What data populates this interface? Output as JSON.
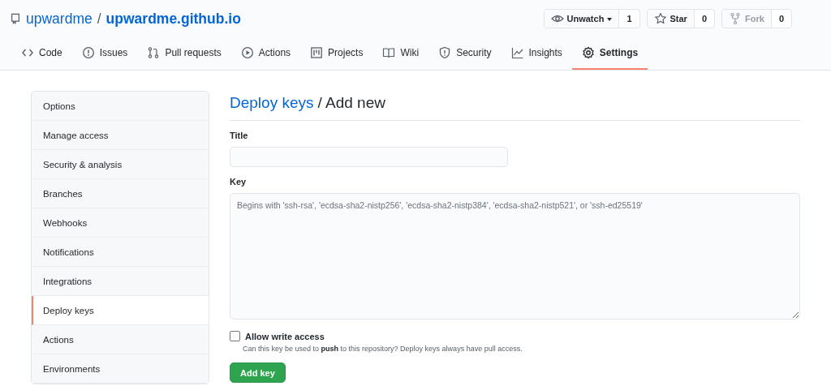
{
  "repo": {
    "owner": "upwardme",
    "separator": "/",
    "name": "upwardme.github.io"
  },
  "repo_actions": [
    {
      "kind": "watch",
      "label": "Unwatch",
      "count": "1",
      "disabled": false,
      "has_menu": true
    },
    {
      "kind": "star",
      "label": "Star",
      "count": "0",
      "disabled": false,
      "has_menu": false
    },
    {
      "kind": "fork",
      "label": "Fork",
      "count": "0",
      "disabled": true,
      "has_menu": false
    }
  ],
  "tabs": [
    {
      "kind": "code",
      "label": "Code",
      "selected": false
    },
    {
      "kind": "issues",
      "label": "Issues",
      "selected": false
    },
    {
      "kind": "pulls",
      "label": "Pull requests",
      "selected": false
    },
    {
      "kind": "actions",
      "label": "Actions",
      "selected": false
    },
    {
      "kind": "projects",
      "label": "Projects",
      "selected": false
    },
    {
      "kind": "wiki",
      "label": "Wiki",
      "selected": false
    },
    {
      "kind": "security",
      "label": "Security",
      "selected": false
    },
    {
      "kind": "insights",
      "label": "Insights",
      "selected": false
    },
    {
      "kind": "settings",
      "label": "Settings",
      "selected": true
    }
  ],
  "sidebar": {
    "items": [
      {
        "label": "Options",
        "selected": false
      },
      {
        "label": "Manage access",
        "selected": false
      },
      {
        "label": "Security & analysis",
        "selected": false
      },
      {
        "label": "Branches",
        "selected": false
      },
      {
        "label": "Webhooks",
        "selected": false
      },
      {
        "label": "Notifications",
        "selected": false
      },
      {
        "label": "Integrations",
        "selected": false
      },
      {
        "label": "Deploy keys",
        "selected": true
      },
      {
        "label": "Actions",
        "selected": false
      },
      {
        "label": "Environments",
        "selected": false
      }
    ]
  },
  "form": {
    "breadcrumb_link": "Deploy keys",
    "heading": "/ Add new",
    "title_label": "Title",
    "key_label": "Key",
    "key_placeholder": "Begins with 'ssh-rsa', 'ecdsa-sha2-nistp256', 'ecdsa-sha2-nistp384', 'ecdsa-sha2-nistp521', or 'ssh-ed25519'",
    "write_access": {
      "label": "Allow write access",
      "checked": false,
      "hint": "Can this key be used to **push** to this repository? Deploy keys always have pull access."
    },
    "submit": "Add key"
  }
}
